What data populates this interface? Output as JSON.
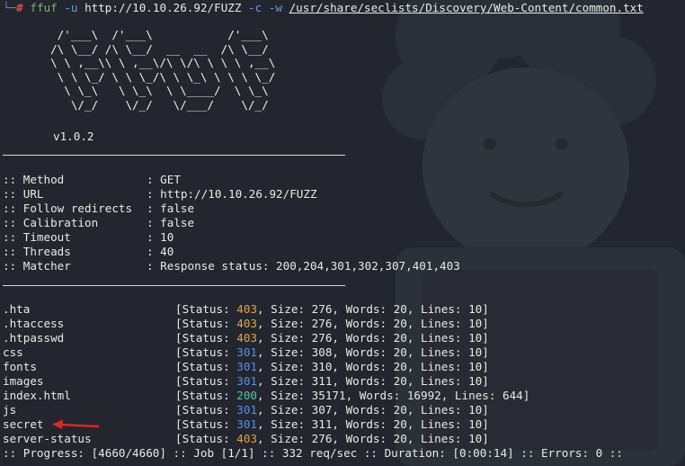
{
  "prompt": {
    "corner": "└─",
    "symbol": "#",
    "command": "ffuf",
    "flag_u": "-u",
    "url_arg": "http://10.10.26.92/FUZZ",
    "flag_c": "-c",
    "flag_w": "-w",
    "wordlist": "/usr/share/seclists/Discovery/Web-Content/common.txt"
  },
  "banner": {
    "ascii_art": "        /'___\\  /'___\\           /'___\\       \n       /\\ \\__/ /\\ \\__/  __  __  /\\ \\__/       \n       \\ \\ ,__\\\\ \\ ,__\\/\\ \\/\\ \\ \\ \\ ,__\\      \n        \\ \\ \\_/ \\ \\ \\_/\\ \\ \\_\\ \\ \\ \\ \\_/      \n         \\ \\_\\   \\ \\_\\  \\ \\____/  \\ \\_\\       \n          \\/_/    \\/_/   \\/___/    \\/_/       ",
    "version": "v1.0.2"
  },
  "config": [
    {
      "key": ":: Method",
      "value": ": GET"
    },
    {
      "key": ":: URL",
      "value": ": http://10.10.26.92/FUZZ"
    },
    {
      "key": ":: Follow redirects",
      "value": ": false"
    },
    {
      "key": ":: Calibration",
      "value": ": false"
    },
    {
      "key": ":: Timeout",
      "value": ": 10"
    },
    {
      "key": ":: Threads",
      "value": ": 40"
    },
    {
      "key": ":: Matcher",
      "value": ": Response status: 200,204,301,302,307,401,403"
    }
  ],
  "results": [
    {
      "name": ".hta",
      "status": "403",
      "size": "276",
      "words": "20",
      "lines": "10"
    },
    {
      "name": ".htaccess",
      "status": "403",
      "size": "276",
      "words": "20",
      "lines": "10"
    },
    {
      "name": ".htpasswd",
      "status": "403",
      "size": "276",
      "words": "20",
      "lines": "10"
    },
    {
      "name": "css",
      "status": "301",
      "size": "308",
      "words": "20",
      "lines": "10"
    },
    {
      "name": "fonts",
      "status": "301",
      "size": "310",
      "words": "20",
      "lines": "10"
    },
    {
      "name": "images",
      "status": "301",
      "size": "311",
      "words": "20",
      "lines": "10"
    },
    {
      "name": "index.html",
      "status": "200",
      "size": "35171",
      "words": "16992",
      "lines": "644"
    },
    {
      "name": "js",
      "status": "301",
      "size": "307",
      "words": "20",
      "lines": "10"
    },
    {
      "name": "secret",
      "status": "301",
      "size": "311",
      "words": "20",
      "lines": "10"
    },
    {
      "name": "server-status",
      "status": "403",
      "size": "276",
      "words": "20",
      "lines": "10"
    }
  ],
  "result_labels": {
    "status": "[Status: ",
    "size": ", Size: ",
    "words": ", Words: ",
    "lines": ", Lines: ",
    "end": "]"
  },
  "progress_line": ":: Progress: [4660/4660] :: Job [1/1] :: 332 req/sec :: Duration: [0:00:14] :: Errors: 0 ::",
  "colors": {
    "background": "#23262e",
    "prompt_hash": "#e14b4b",
    "command": "#6fb86f",
    "flag": "#6a9be0",
    "status_403": "#e0a44a",
    "status_301": "#5a8fe6",
    "status_200": "#57c4a6",
    "arrow": "#e0242a"
  },
  "icons": [
    "red-arrow-icon"
  ]
}
